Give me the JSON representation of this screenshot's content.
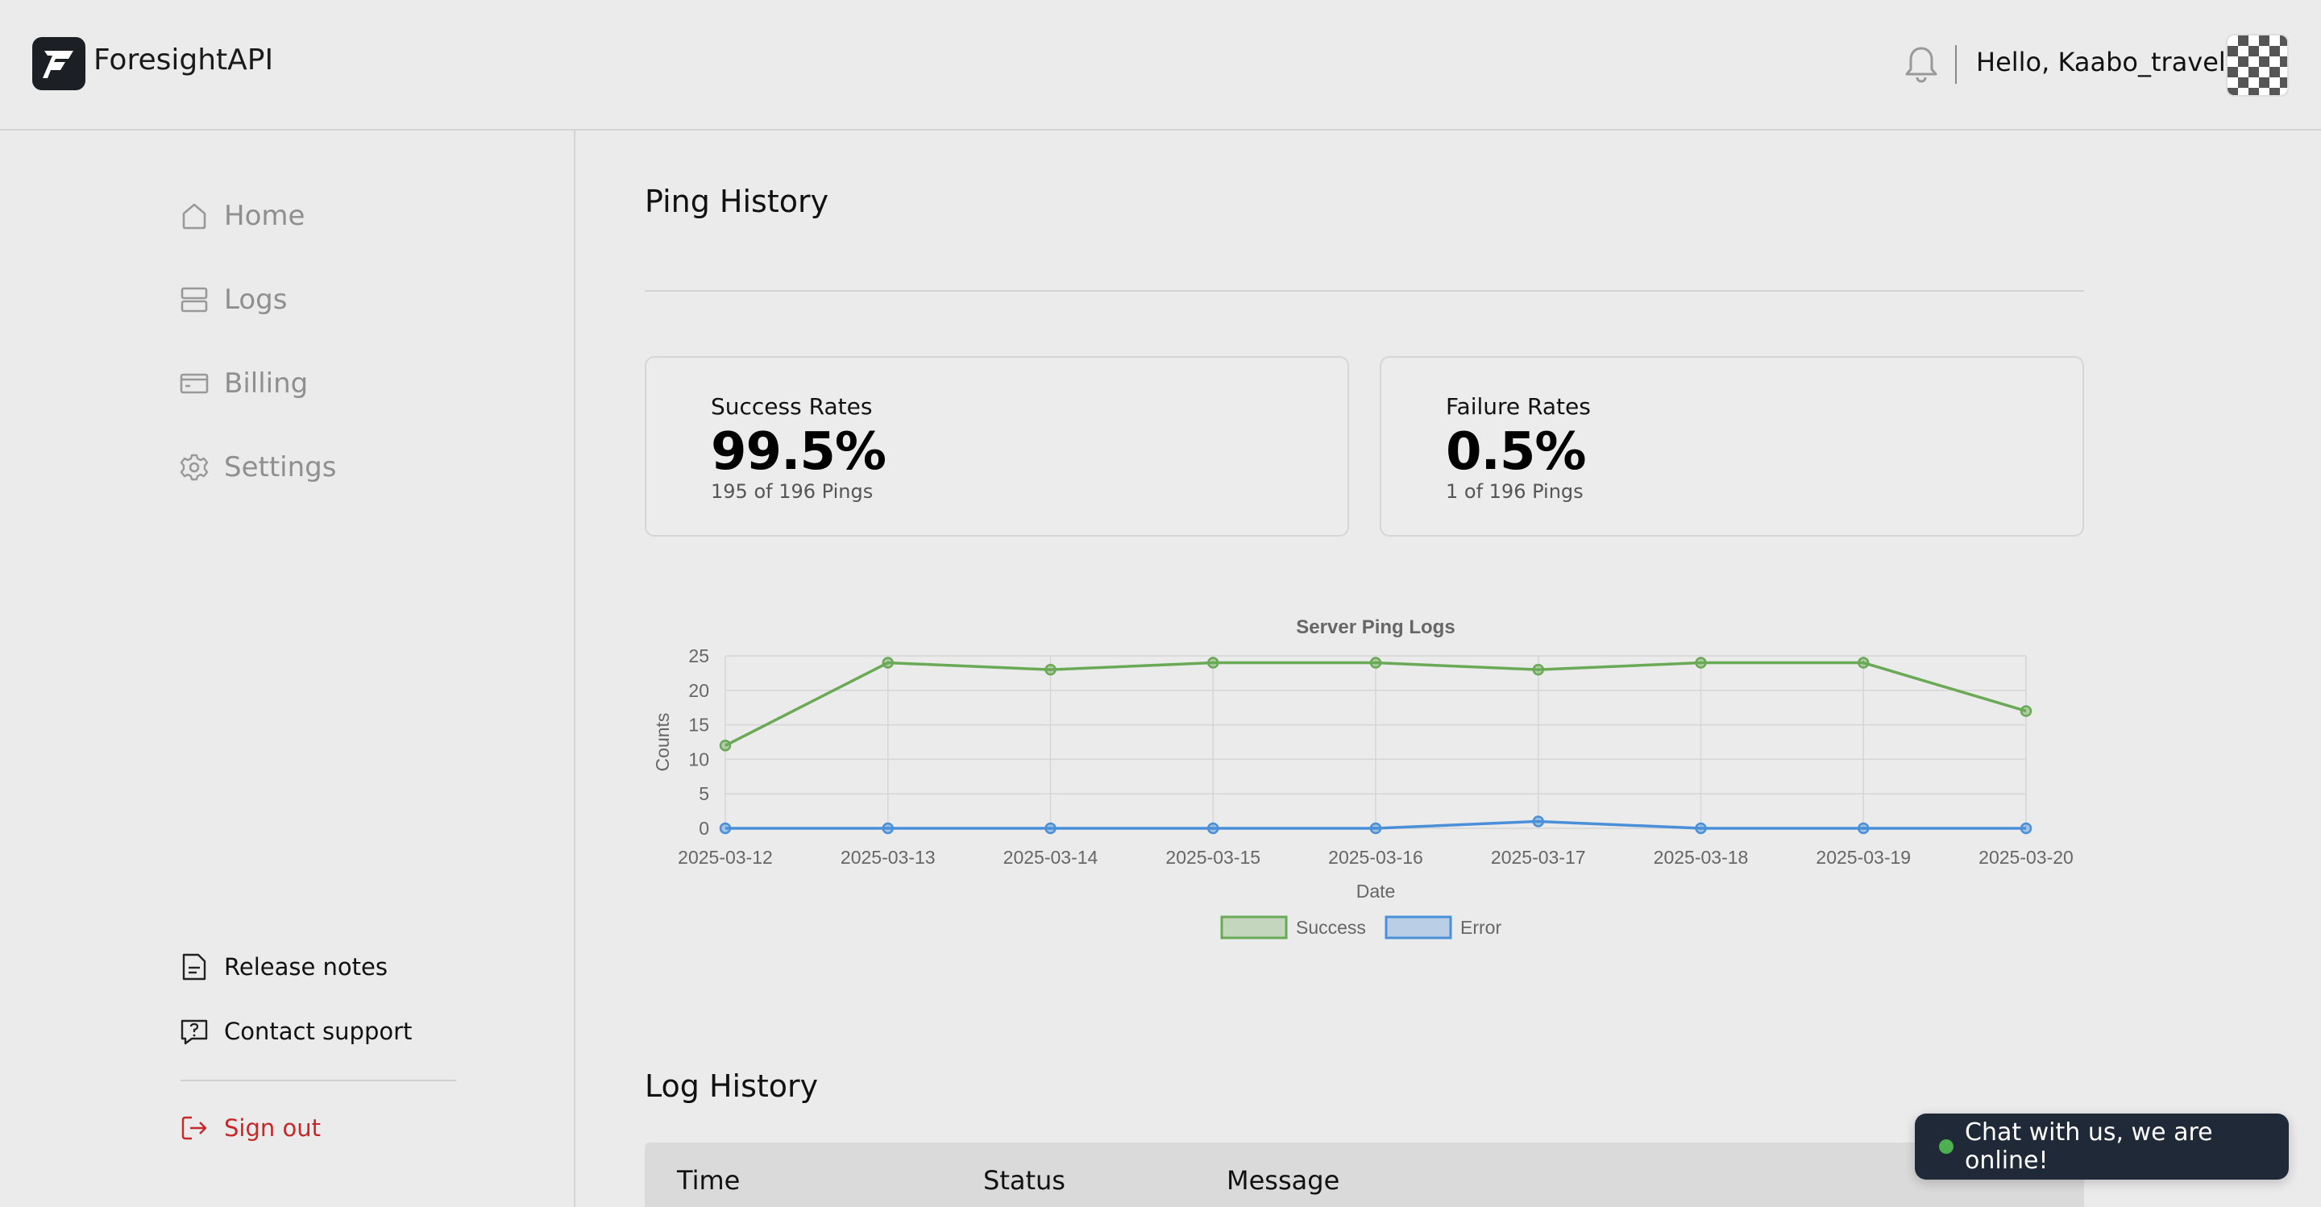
{
  "header": {
    "brand": "ForesightAPI",
    "greeting": "Hello, Kaabo_travel"
  },
  "sidebar": {
    "items": [
      {
        "label": "Home",
        "icon": "home-icon"
      },
      {
        "label": "Logs",
        "icon": "server-icon"
      },
      {
        "label": "Billing",
        "icon": "credit-card-icon"
      },
      {
        "label": "Settings",
        "icon": "gear-icon"
      }
    ],
    "bottom": [
      {
        "label": "Release notes",
        "icon": "document-icon"
      },
      {
        "label": "Contact support",
        "icon": "chat-question-icon"
      }
    ],
    "signout": "Sign out"
  },
  "main": {
    "title": "Ping History",
    "cards": [
      {
        "label": "Success Rates",
        "value": "99.5%",
        "sub": "195 of 196 Pings"
      },
      {
        "label": "Failure Rates",
        "value": "0.5%",
        "sub": "1 of 196 Pings"
      }
    ],
    "log_title": "Log History",
    "table_headers": [
      "Time",
      "Status",
      "Message"
    ]
  },
  "chat": {
    "label": "Chat with us, we are online!"
  },
  "colors": {
    "success": "#6aaa57",
    "error": "#4a90d9",
    "signout": "#c62828",
    "chat_bg": "#1f2937"
  },
  "chart_data": {
    "type": "line",
    "title": "Server Ping Logs",
    "xlabel": "Date",
    "ylabel": "Counts",
    "ylim": [
      0,
      25
    ],
    "yticks": [
      0,
      5,
      10,
      15,
      20,
      25
    ],
    "categories": [
      "2025-03-12",
      "2025-03-13",
      "2025-03-14",
      "2025-03-15",
      "2025-03-16",
      "2025-03-17",
      "2025-03-18",
      "2025-03-19",
      "2025-03-20"
    ],
    "series": [
      {
        "name": "Success",
        "color": "#6aaa57",
        "values": [
          12,
          24,
          23,
          24,
          24,
          23,
          24,
          24,
          17
        ]
      },
      {
        "name": "Error",
        "color": "#4a90d9",
        "values": [
          0,
          0,
          0,
          0,
          0,
          1,
          0,
          0,
          0
        ]
      }
    ],
    "grid": true,
    "legend": "bottom"
  }
}
